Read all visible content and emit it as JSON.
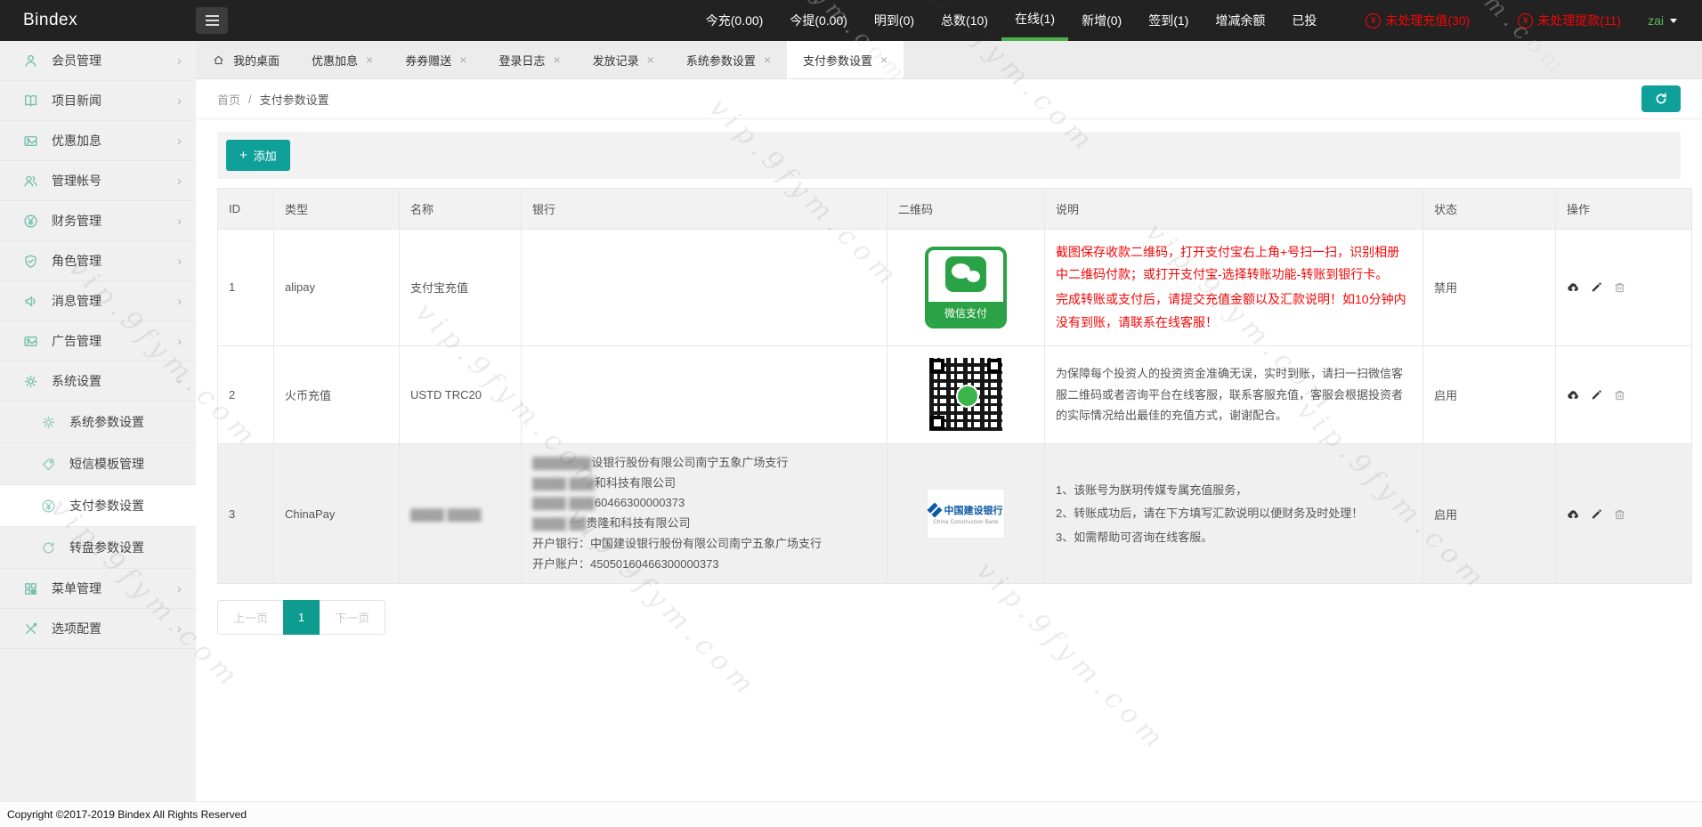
{
  "watermark": {
    "text": "vip.9fym.com"
  },
  "ui": {
    "tab_close_glyph": "×",
    "chevron_glyph": "›"
  },
  "topbar": {
    "brand": "Bindex",
    "stats": [
      {
        "label": "今充(0.00)"
      },
      {
        "label": "今提(0.00)"
      },
      {
        "label": "明到(0)"
      },
      {
        "label": "总数(10)"
      },
      {
        "label": "在线(1)",
        "active": true
      },
      {
        "label": "新增(0)"
      },
      {
        "label": "签到(1)"
      },
      {
        "label": "增减余额"
      },
      {
        "label": "已投"
      }
    ],
    "alerts": [
      {
        "icon_glyph": "¥",
        "label": "未处理充值(30)"
      },
      {
        "icon_glyph": "¥",
        "label": "未处理提款(11)"
      }
    ],
    "user": "zai"
  },
  "sidebar": {
    "items": [
      {
        "label": "会员管理"
      },
      {
        "label": "项目新闻"
      },
      {
        "label": "优惠加息"
      },
      {
        "label": "管理帐号"
      },
      {
        "label": "财务管理"
      },
      {
        "label": "角色管理"
      },
      {
        "label": "消息管理"
      },
      {
        "label": "广告管理"
      },
      {
        "label": "系统设置",
        "expanded": true
      },
      {
        "label": "系统参数设置",
        "sub": true
      },
      {
        "label": "短信模板管理",
        "sub": true
      },
      {
        "label": "支付参数设置",
        "sub": true,
        "active": true
      },
      {
        "label": "转盘参数设置",
        "sub": true
      },
      {
        "label": "菜单管理"
      },
      {
        "label": "选项配置"
      }
    ]
  },
  "tabs": [
    {
      "label": "我的桌面",
      "closable": false
    },
    {
      "label": "优惠加息",
      "closable": true
    },
    {
      "label": "券券赠送",
      "closable": true
    },
    {
      "label": "登录日志",
      "closable": true
    },
    {
      "label": "发放记录",
      "closable": true
    },
    {
      "label": "系统参数设置",
      "closable": true
    },
    {
      "label": "支付参数设置",
      "closable": true,
      "active": true
    }
  ],
  "breadcrumb": {
    "home": "首页",
    "sep": "/",
    "current": "支付参数设置"
  },
  "toolbar": {
    "add_icon": "+",
    "add_label": "添加"
  },
  "table": {
    "headers": [
      "ID",
      "类型",
      "名称",
      "银行",
      "二维码",
      "说明",
      "状态",
      "操作"
    ],
    "rows": [
      {
        "id": "1",
        "type": "alipay",
        "name": "支付宝充值",
        "bank": "",
        "qr_kind": "wechat-pay-badge",
        "qr_label": "微信支付",
        "desc": [
          "截图保存收款二维码，打开支付宝右上角+号扫一扫，识别相册中二维码付款；或打开支付宝-选择转账功能-转账到银行卡。",
          "完成转账或支付后，请提交充值金额以及汇款说明！如10分钟内没有到账，请联系在线客服！"
        ],
        "status": "禁用"
      },
      {
        "id": "2",
        "type": "火币充值",
        "name": "USTD TRC20",
        "bank": "",
        "qr_kind": "qr-code",
        "desc": [
          "为保障每个投资人的投资资金准确无误，实时到账，请扫一扫微信客服二维码或者咨询平台在线客服，联系客服充值，客服会根据投资者的实际情况给出最佳的充值方式，谢谢配合。"
        ],
        "status": "启用"
      },
      {
        "id": "3",
        "type": "ChinaPay",
        "name_blur": "▓▓▓▓ ▓▓▓▓",
        "bank_lines": [
          {
            "blur": "▓▓▓▓▓▓▓",
            "text": "设银行股份有限公司南宁五象广场支行"
          },
          {
            "blur": "▓▓▓▓ ▓▓▓",
            "text": "和科技有限公司"
          },
          {
            "blur": "▓▓▓▓ ▓▓▓",
            "text": "60466300000373"
          },
          {
            "blur": "▓▓▓▓ ▓▓",
            "text": "贵隆和科技有限公司"
          },
          {
            "blur": "",
            "text": "开户银行：中国建设银行股份有限公司南宁五象广场支行"
          },
          {
            "blur": "",
            "text": "开户账户：45050160466300000373"
          }
        ],
        "qr_kind": "ccb-logo",
        "bank_logo": {
          "cn": "中国建设银行",
          "en": "China Construction Bank"
        },
        "desc": [
          "1、该账号为朕玥传媒专属充值服务，",
          "2、转账成功后，请在下方填写汇款说明以便财务及时处理！",
          "3、如需帮助可咨询在线客服。"
        ],
        "status": "启用"
      }
    ]
  },
  "pagination": {
    "prev": "上一页",
    "page": "1",
    "next": "下一页"
  },
  "footer": {
    "copyright": "Copyright ©2017-2019 Bindex All Rights Reserved"
  },
  "colors": {
    "topbar_bg": "#222222",
    "accent_teal": "#10a09a",
    "active_green": "#4cae4c",
    "danger_red": "#f40606",
    "wechat_green": "#2ba245",
    "ccb_blue": "#0b5aa6",
    "sidebar_bg": "#f0f0f0"
  }
}
